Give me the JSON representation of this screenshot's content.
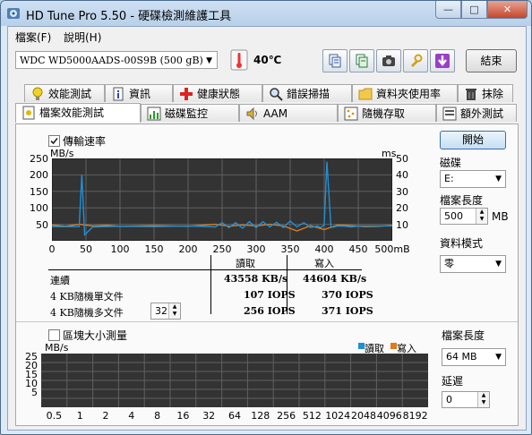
{
  "window": {
    "title": "HD Tune Pro 5.50 - 硬碟檢測維護工具",
    "minimize": "—",
    "maximize": "□",
    "close": "✕"
  },
  "menu": {
    "file": "檔案(F)",
    "help": "說明(H)"
  },
  "toolbar": {
    "drive": "WDC WD5000AADS-00S9B (500 gB)",
    "temperature": "40℃",
    "exit_label": "結束",
    "icons": [
      "copy-text-icon",
      "copy-info-icon",
      "screenshot-icon",
      "options-icon",
      "save-icon"
    ]
  },
  "tabs_row1": [
    "效能測試",
    "資訊",
    "健康狀態",
    "錯誤掃描",
    "資料夾使用率",
    "抹除"
  ],
  "tabs_row2": [
    "檔案效能測試",
    "磁碟監控",
    "AAM",
    "隨機存取",
    "額外測試"
  ],
  "tabs_row1_icons": [
    "bulb-icon",
    "info-icon",
    "health-cross-icon",
    "scan-magnifier-icon",
    "folder-icon",
    "trash-icon"
  ],
  "tabs_row2_icons": [
    "file-benchmark-icon",
    "monitor-chart-icon",
    "speaker-icon",
    "random-access-icon",
    "extra-tests-icon"
  ],
  "transfer": {
    "checkbox_label": "傳輸速率",
    "checked": true,
    "y_left_unit": "MB/s",
    "y_right_unit": "ms",
    "y_left_ticks": [
      "250",
      "200",
      "150",
      "100",
      "50"
    ],
    "y_right_ticks": [
      "50",
      "40",
      "30",
      "20",
      "10"
    ],
    "x_ticks": [
      "0",
      "50",
      "100",
      "150",
      "200",
      "250",
      "300",
      "350",
      "400",
      "450",
      "500mB"
    ]
  },
  "results": {
    "col_read": "讀取",
    "col_write": "寫入",
    "rows": [
      {
        "label": "連續",
        "read": "43558 KB/s",
        "write": "44604 KB/s"
      },
      {
        "label": "4 KB隨機單文件",
        "read": "107 IOPS",
        "write": "370 IOPS"
      },
      {
        "label": "4 KB隨機多文件",
        "read": "256 IOPS",
        "write": "371 IOPS",
        "queue": "32"
      }
    ]
  },
  "side": {
    "start_label": "開始",
    "drive_label": "磁碟",
    "drive_value": "E:",
    "filelen_label": "檔案長度",
    "filelen_value": "500",
    "filelen_unit": "MB",
    "mode_label": "資料模式",
    "mode_value": "零"
  },
  "block": {
    "checkbox_label": "區塊大小測量",
    "checked": false,
    "unit": "MB/s",
    "legend_read": "讀取",
    "legend_write": "寫入",
    "y_ticks": [
      "25",
      "20",
      "15",
      "10",
      "5"
    ],
    "x_ticks": [
      "0.5",
      "1",
      "2",
      "4",
      "8",
      "16",
      "32",
      "64",
      "128",
      "256",
      "512",
      "1024",
      "2048",
      "4096",
      "8192"
    ],
    "filelen_label": "檔案長度",
    "filelen_value": "64 MB",
    "delay_label": "延遲",
    "delay_value": "0"
  },
  "colors": {
    "read": "#1e90d8",
    "write": "#e07b1a",
    "plot_bg": "#333333",
    "grid": "#606060"
  },
  "chart_data": {
    "type": "line",
    "x_unit": "mB",
    "xlim": [
      0,
      500
    ],
    "ylim_left": [
      0,
      250
    ],
    "ylim_right": [
      0,
      50
    ],
    "series": [
      {
        "name": "讀取",
        "x": [
          0,
          40,
          44,
          48,
          60,
          100,
          150,
          200,
          240,
          250,
          260,
          270,
          280,
          290,
          300,
          310,
          320,
          330,
          340,
          350,
          360,
          370,
          380,
          390,
          395,
          400,
          404,
          410,
          420,
          430,
          440,
          450,
          500
        ],
        "y": [
          43,
          43,
          200,
          18,
          42,
          44,
          43,
          45,
          42,
          55,
          40,
          55,
          38,
          58,
          40,
          58,
          42,
          56,
          40,
          60,
          42,
          55,
          40,
          45,
          40,
          48,
          240,
          40,
          45,
          44,
          42,
          45,
          45
        ]
      },
      {
        "name": "寫入",
        "x": [
          0,
          20,
          40,
          60,
          80,
          100,
          150,
          200,
          240,
          260,
          280,
          300,
          320,
          340,
          360,
          380,
          400,
          420,
          440,
          460,
          480,
          500
        ],
        "y": [
          48,
          44,
          50,
          45,
          47,
          44,
          46,
          44,
          50,
          44,
          48,
          45,
          50,
          45,
          30,
          46,
          34,
          48,
          46,
          43,
          44,
          47
        ]
      }
    ]
  }
}
